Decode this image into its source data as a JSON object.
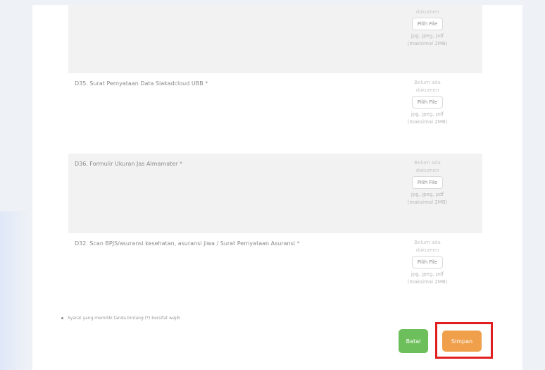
{
  "rows": [
    {
      "label": "",
      "required": "",
      "status": "dokumen",
      "choose_label": "Pilih File",
      "formats": "jpg, jpeg, pdf (maksimal 2MB)"
    },
    {
      "label": "D35. Surat Pernyataan Data Siakadcloud UBB",
      "required": " *",
      "status": "Belum ada dokumen",
      "choose_label": "Pilih File",
      "formats": "jpg, jpeg, pdf (maksimal 2MB)"
    },
    {
      "label": "D36. Formulir Ukuran Jas Almamater",
      "required": " *",
      "status": "Belum ada dokumen",
      "choose_label": "Pilih File",
      "formats": "jpg, jpeg, pdf (maksimal 2MB)"
    },
    {
      "label": "D32. Scan BPJS/asuransi kesehatan, asuransi jiwa / Surat Pernyataan Asuransi",
      "required": " *",
      "status": "Belum ada dokumen",
      "choose_label": "Pilih File",
      "formats": "jpg, jpeg, pdf (maksimal 2MB)"
    }
  ],
  "note": "Syarat yang memiliki tanda bintang (*) bersifat wajib",
  "buttons": {
    "cancel": "Batal",
    "save": "Simpan"
  },
  "colors": {
    "cancel": "#6dbf5b",
    "save": "#f0a04b",
    "highlight": "#e02020"
  }
}
